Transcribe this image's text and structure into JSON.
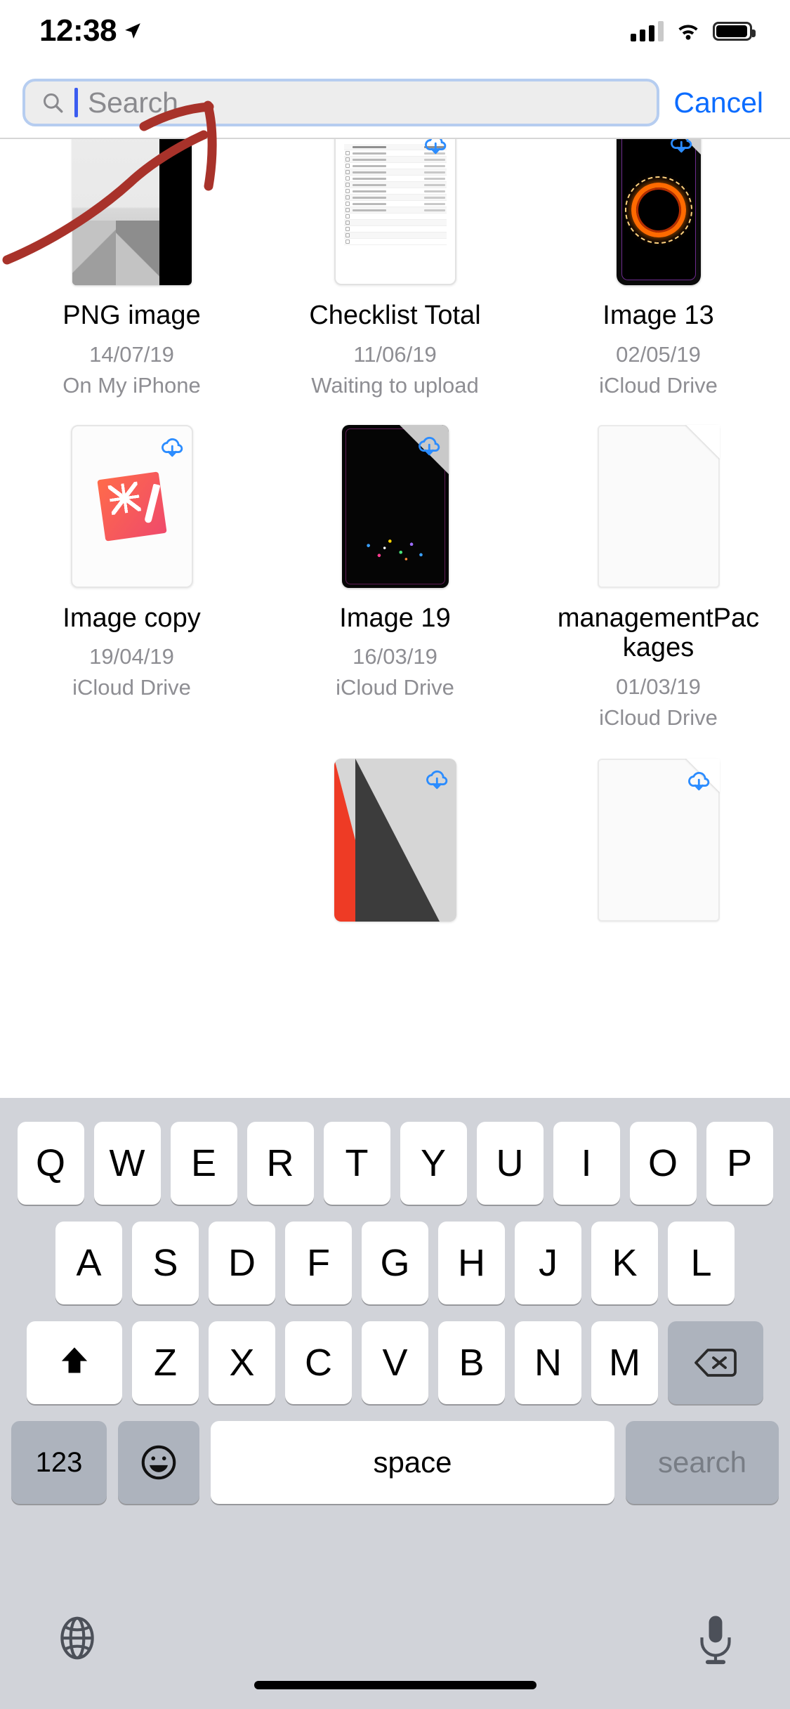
{
  "status_bar": {
    "time": "12:38",
    "location_icon": "location-arrow-icon",
    "signal_icon": "cellular-signal-icon",
    "wifi_icon": "wifi-icon",
    "battery_icon": "battery-full-icon"
  },
  "search": {
    "placeholder": "Search",
    "value": "",
    "cancel_label": "Cancel",
    "icon": "search-icon",
    "accent": "#0b6cff",
    "focus_border": "#b6cdf0",
    "caret_color": "#3b5cf0"
  },
  "files": [
    {
      "name": "PNG image",
      "date": "14/07/19",
      "location": "On My iPhone",
      "thumb": "png-image-thumbnail",
      "cloud_badge": false
    },
    {
      "name": "Checklist Total",
      "date": "11/06/19",
      "location": "Waiting to upload",
      "thumb": "spreadsheet-thumbnail",
      "cloud_badge": true
    },
    {
      "name": "Image 13",
      "date": "02/05/19",
      "location": "iCloud Drive",
      "thumb": "phone-wallpaper-thumbnail",
      "cloud_badge": true
    },
    {
      "name": "Image copy",
      "date": "19/04/19",
      "location": "iCloud Drive",
      "thumb": "pixelmator-app-thumbnail",
      "cloud_badge": true
    },
    {
      "name": "Image 19",
      "date": "16/03/19",
      "location": "iCloud Drive",
      "thumb": "dark-phone-thumbnail",
      "cloud_badge": true
    },
    {
      "name": "managementPackages",
      "date": "01/03/19",
      "location": "iCloud Drive",
      "thumb": "blank-document-thumbnail",
      "cloud_badge": false
    },
    {
      "name": "",
      "date": "",
      "location": "",
      "thumb": "red-dark-triangle-thumbnail",
      "cloud_badge": true
    },
    {
      "name": "",
      "date": "",
      "location": "",
      "thumb": "blank-document-thumbnail",
      "cloud_badge": true
    }
  ],
  "annotation": {
    "type": "hand-drawn-arrow",
    "color": "#a8322a",
    "points_to": "search-input"
  },
  "keyboard": {
    "row1": [
      "Q",
      "W",
      "E",
      "R",
      "T",
      "Y",
      "U",
      "I",
      "O",
      "P"
    ],
    "row2": [
      "A",
      "S",
      "D",
      "F",
      "G",
      "H",
      "J",
      "K",
      "L"
    ],
    "row3": [
      "Z",
      "X",
      "C",
      "V",
      "B",
      "N",
      "M"
    ],
    "shift_icon": "shift-up-arrow-icon",
    "delete_icon": "delete-backspace-icon",
    "numbers_label": "123",
    "emoji_icon": "emoji-smiley-icon",
    "space_label": "space",
    "return_label": "search",
    "globe_icon": "globe-icon",
    "mic_icon": "microphone-icon",
    "key_bg": "#ffffff",
    "fn_key_bg": "#adb3bd",
    "keyboard_bg": "#d1d3d9"
  }
}
